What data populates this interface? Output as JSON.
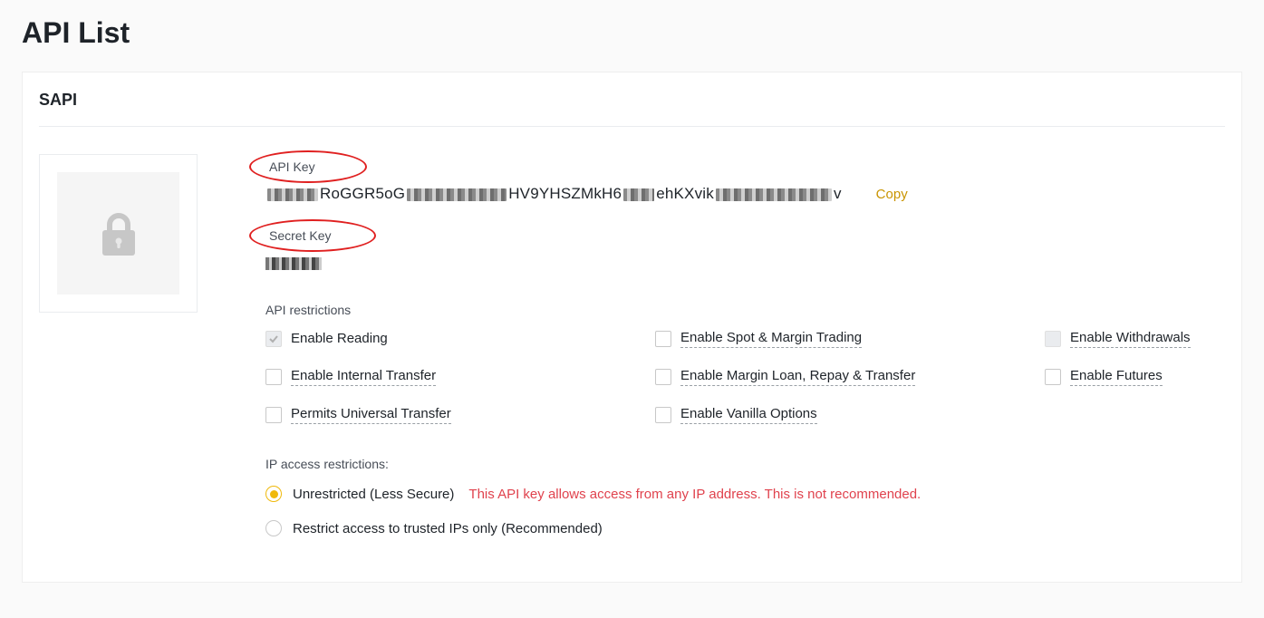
{
  "page": {
    "title": "API List"
  },
  "card": {
    "name": "SAPI",
    "api_key": {
      "label": "API Key",
      "seg1": "RoGGR5oG",
      "seg2": "HV9YHSZMkH6",
      "seg3": "ehKXvik",
      "seg4": "v",
      "copy_label": "Copy"
    },
    "secret_key": {
      "label": "Secret Key"
    },
    "restrictions": {
      "title": "API restrictions",
      "items": [
        {
          "label": "Enable Reading",
          "checked": true,
          "disabled": true,
          "dashed": false
        },
        {
          "label": "Enable Spot & Margin Trading",
          "checked": false,
          "disabled": false,
          "dashed": true
        },
        {
          "label": "Enable Withdrawals",
          "checked": false,
          "disabled": true,
          "dashed": true
        },
        {
          "label": "Enable Internal Transfer",
          "checked": false,
          "disabled": false,
          "dashed": true
        },
        {
          "label": "Enable Margin Loan, Repay & Transfer",
          "checked": false,
          "disabled": false,
          "dashed": true
        },
        {
          "label": "Enable Futures",
          "checked": false,
          "disabled": false,
          "dashed": true
        },
        {
          "label": "Permits Universal Transfer",
          "checked": false,
          "disabled": false,
          "dashed": true
        },
        {
          "label": "Enable Vanilla Options",
          "checked": false,
          "disabled": false,
          "dashed": true
        }
      ]
    },
    "ip": {
      "title": "IP access restrictions:",
      "options": [
        {
          "label": "Unrestricted (Less Secure)",
          "selected": true,
          "warning": "This API key allows access from any IP address. This is not recommended."
        },
        {
          "label": "Restrict access to trusted IPs only (Recommended)",
          "selected": false
        }
      ]
    }
  }
}
